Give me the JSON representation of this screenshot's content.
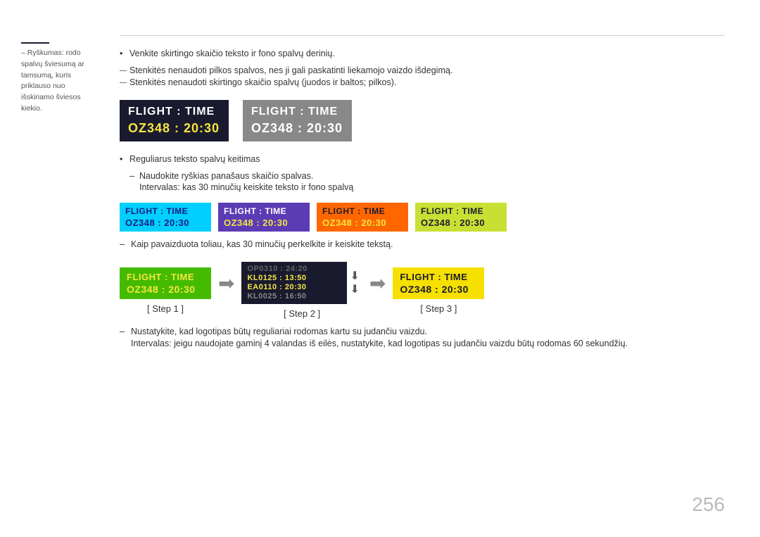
{
  "page": {
    "number": "256"
  },
  "sidebar": {
    "note_intro": "– Ryškumas: rodo spalvų šviesumą ar tamsumą, kuris priklauso nuo išskiriamo šviesos kiekio."
  },
  "top_bullets": [
    "Venkite skirtingo skaičio teksto ir fono spalvų derinių.",
    "Stenkitės nenaudoti pilkos spalvos, nes ji gali paskatinti liekamojo vaizdo išdegimą.",
    "Stenkitės nenaudoti skirtingo skaičio spalvų (juodos ir baltos; pilkos)."
  ],
  "flight_box_1": {
    "row1": "FLIGHT  :  TIME",
    "row2": "OZ348   :  20:30"
  },
  "flight_box_2": {
    "row1": "FLIGHT  :  TIME",
    "row2": "OZ348   :  20:30"
  },
  "mid_section": {
    "bullet1": "Reguliarus teksto spalvų keitimas",
    "dash1": "Naudokite ryškias panašaus skaičio spalvas.",
    "dash2": "Intervalas: kas 30 minučių keiskite teksto ir fono spalvą"
  },
  "small_boxes": [
    {
      "row1": "FLIGHT  :  TIME",
      "row2": "OZ348   :  20:30",
      "theme": "cyan"
    },
    {
      "row1": "FLIGHT  :  TIME",
      "row2": "OZ348   :  20:30",
      "theme": "purple"
    },
    {
      "row1": "FLIGHT  :  TIME",
      "row2": "OZ348   :  20:30",
      "theme": "orange"
    },
    {
      "row1": "FLIGHT  :  TIME",
      "row2": "OZ348   :  20:30",
      "theme": "yellowgreen"
    }
  ],
  "scroll_info": {
    "dash1": "Kaip pavaizduota toliau, kas 30 minučių perkelkite ir keiskite tekstą."
  },
  "steps": {
    "step1": {
      "label": "[ Step 1 ]",
      "row1": "FLIGHT  :  TIME",
      "row2": "OZ348   :  20:30"
    },
    "step2": {
      "label": "[ Step 2 ]",
      "rows": [
        {
          "text": "OP0310 : 24:20",
          "style": "faded"
        },
        {
          "text": "KL0125 : 13:50",
          "style": "active"
        },
        {
          "text": "EA0110 : 20:30",
          "style": "active"
        },
        {
          "text": "KL0025 : 16:50",
          "style": "dim"
        }
      ]
    },
    "step3": {
      "label": "[ Step 3 ]",
      "row1": "FLIGHT  :  TIME",
      "row2": "OZ348   :  20:30"
    }
  },
  "bottom_notes": {
    "dash1": "Nustatykite, kad logotipas būtų reguliariai rodomas kartu su judančiu vaizdu.",
    "dash2": "Intervalas: jeigu naudojate gaminį 4 valandas iš eilės, nustatykite, kad logotipas su judančiu vaizdu būtų rodomas 60 sekundžių."
  }
}
